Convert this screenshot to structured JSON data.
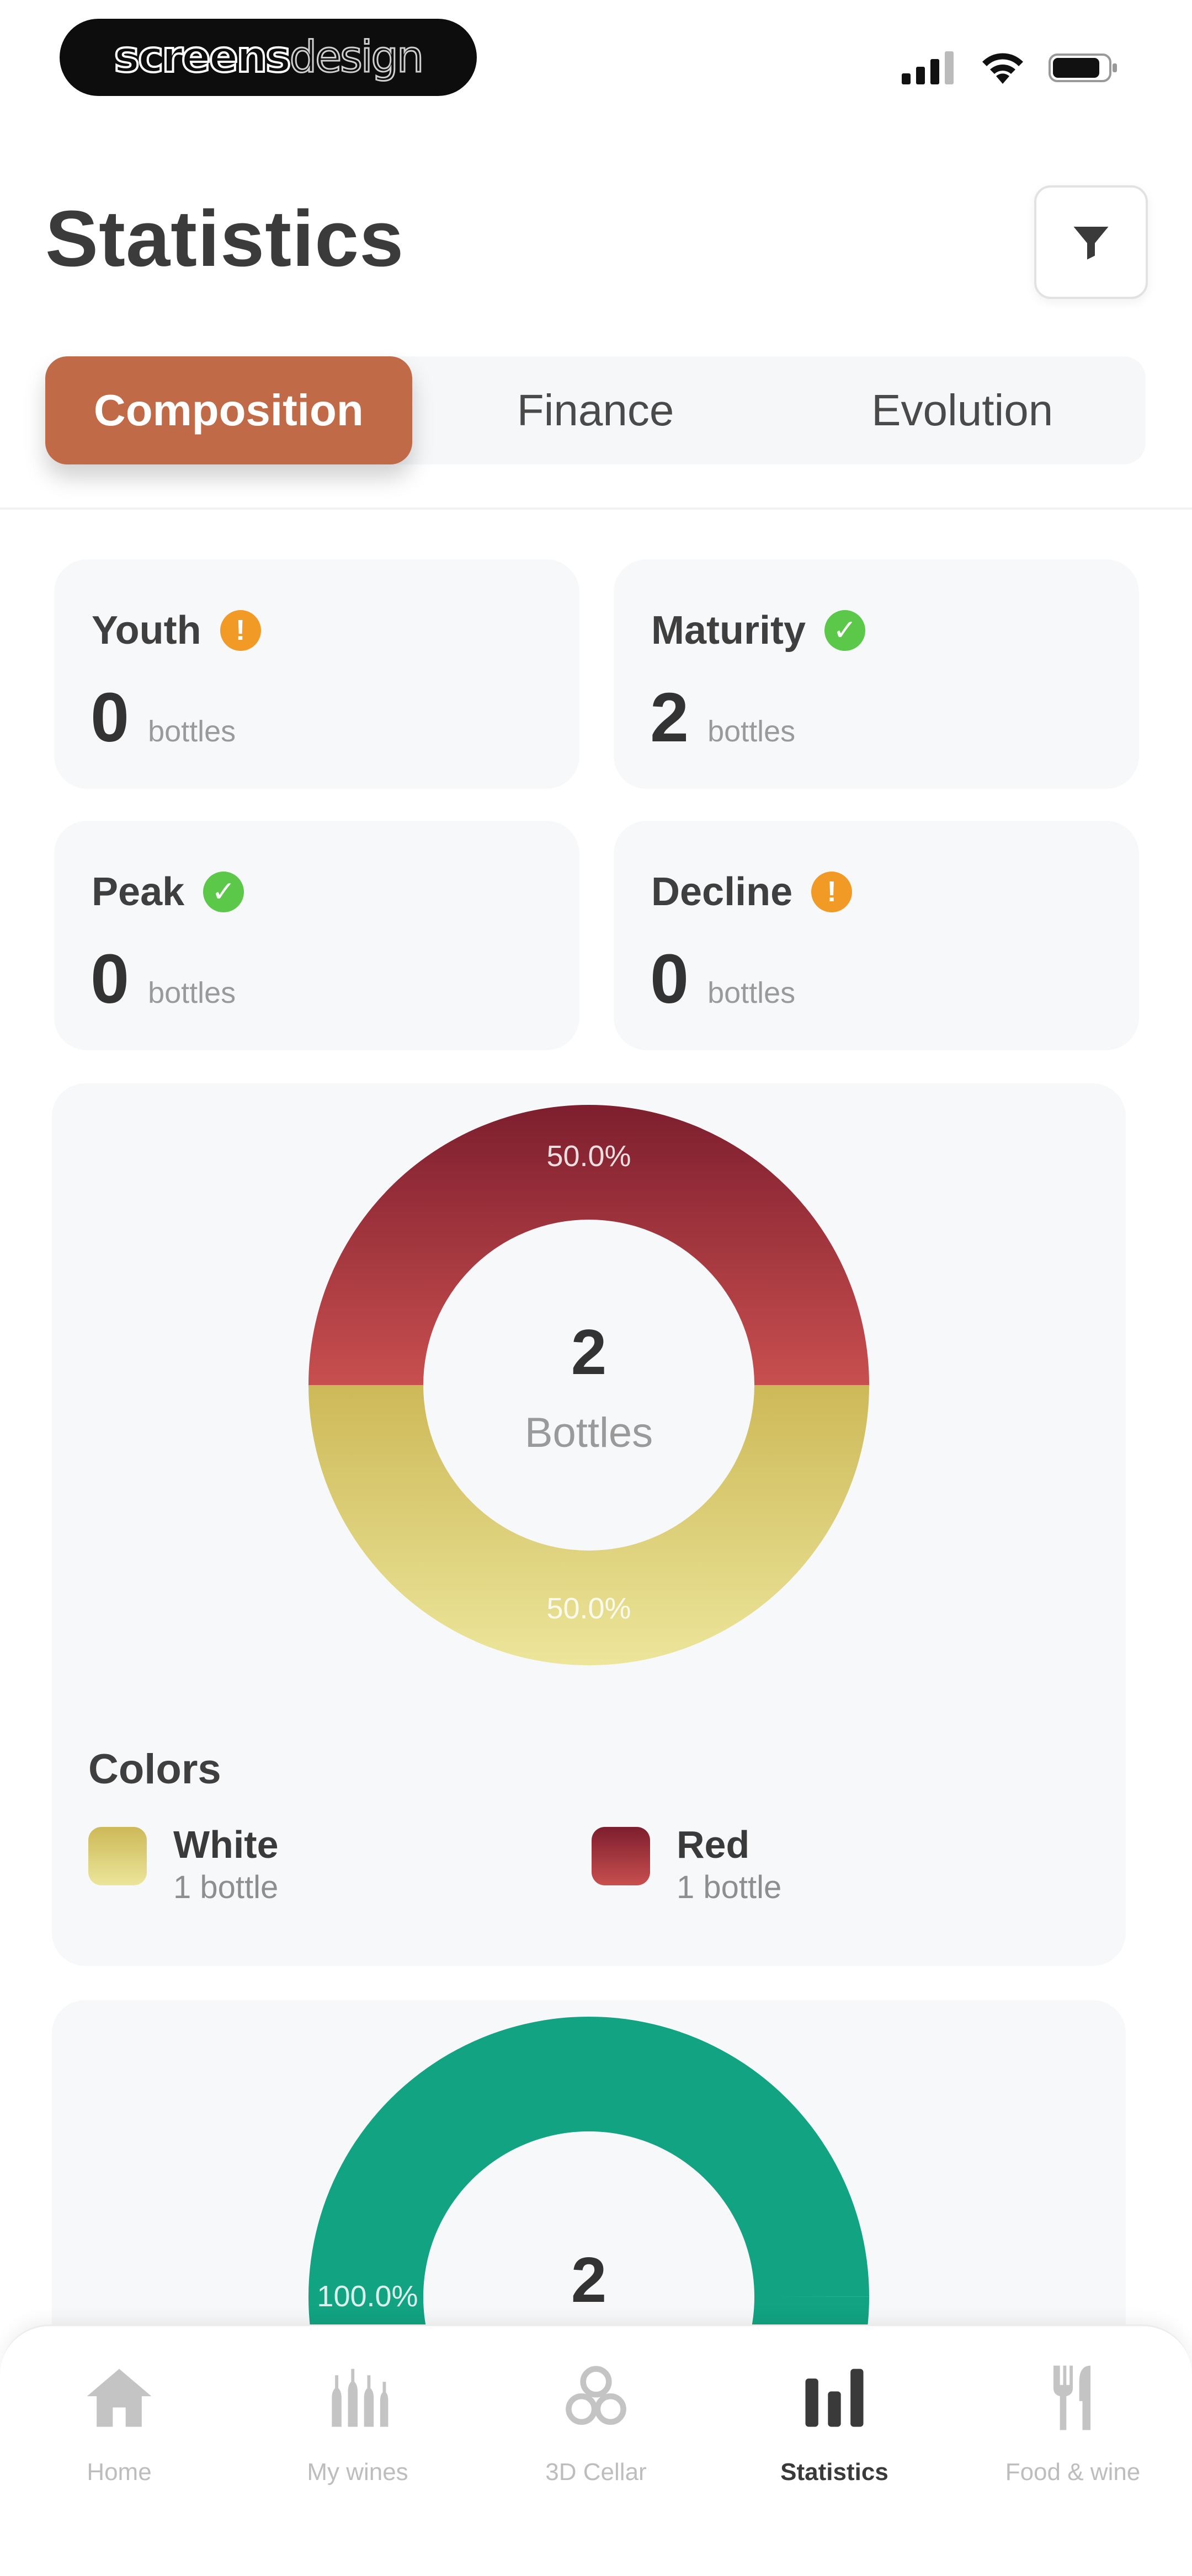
{
  "status_bar": {
    "brand_part1": "screens",
    "brand_part2": "design"
  },
  "header": {
    "title": "Statistics"
  },
  "tabs": [
    {
      "label": "Composition",
      "active": true
    },
    {
      "label": "Finance",
      "active": false
    },
    {
      "label": "Evolution",
      "active": false
    }
  ],
  "status_cards": [
    {
      "label": "Youth",
      "value": "0",
      "unit": "bottles",
      "status": "warning"
    },
    {
      "label": "Maturity",
      "value": "2",
      "unit": "bottles",
      "status": "ok"
    },
    {
      "label": "Peak",
      "value": "0",
      "unit": "bottles",
      "status": "ok"
    },
    {
      "label": "Decline",
      "value": "0",
      "unit": "bottles",
      "status": "warning"
    }
  ],
  "colors": {
    "accent": "#c06a48",
    "warning": "#f29a26",
    "ok": "#5cc84a",
    "red_wine_top": "#7d1e2e",
    "red_wine_bottom": "#c84f4f",
    "white_wine_top": "#cdb958",
    "white_wine_bottom": "#ece59a",
    "teal": "#12a382"
  },
  "chart_data": [
    {
      "type": "pie",
      "title": "Colors",
      "center_value": "2",
      "center_label": "Bottles",
      "slices": [
        {
          "name": "Red",
          "value": 50.0,
          "label": "50.0%",
          "count": "1 bottle"
        },
        {
          "name": "White",
          "value": 50.0,
          "label": "50.0%",
          "count": "1 bottle"
        }
      ]
    },
    {
      "type": "pie",
      "center_value": "2",
      "slices": [
        {
          "value": 100.0,
          "label": "100.0%"
        }
      ]
    }
  ],
  "legend": {
    "white_name": "White",
    "white_count": "1 bottle",
    "red_name": "Red",
    "red_count": "1 bottle"
  },
  "bottom_nav": [
    {
      "label": "Home",
      "icon": "home-icon",
      "active": false
    },
    {
      "label": "My wines",
      "icon": "wine-bottles-icon",
      "active": false
    },
    {
      "label": "3D Cellar",
      "icon": "cellar-icon",
      "active": false
    },
    {
      "label": "Statistics",
      "icon": "bar-chart-icon",
      "active": true
    },
    {
      "label": "Food & wine",
      "icon": "fork-knife-icon",
      "active": false
    }
  ]
}
